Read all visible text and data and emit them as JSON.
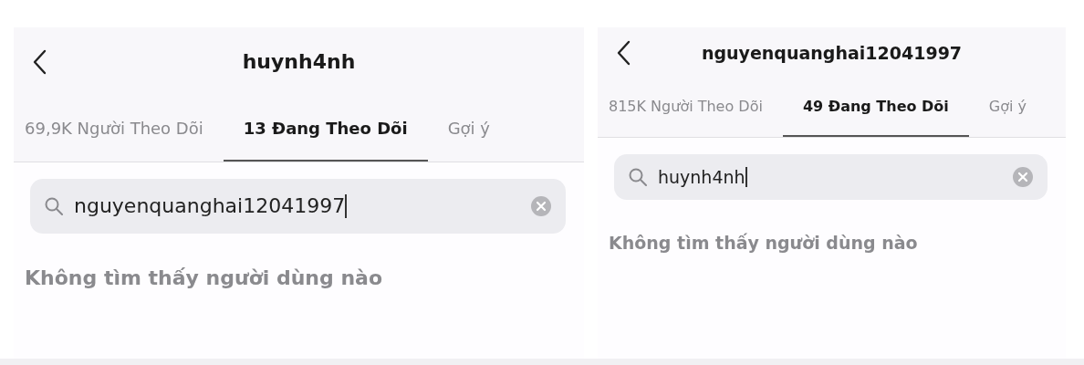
{
  "screens": [
    {
      "title": "huynh4nh",
      "tabs": [
        {
          "label": "69,9K Người Theo Dõi",
          "selected": false
        },
        {
          "label": "13 Đang Theo Dõi",
          "selected": true
        },
        {
          "label": "Gợi ý",
          "selected": false
        }
      ],
      "search": {
        "value": "nguyenquanghai12041997"
      },
      "message": "Không tìm thấy người dùng nào"
    },
    {
      "title": "nguyenquanghai12041997",
      "tabs": [
        {
          "label": "815K Người Theo Dõi",
          "selected": false
        },
        {
          "label": "49 Đang Theo Dõi",
          "selected": true
        },
        {
          "label": "Gợi ý",
          "selected": false
        }
      ],
      "search": {
        "value": "huynh4nh"
      },
      "message": "Không tìm thấy người dùng nào"
    }
  ]
}
